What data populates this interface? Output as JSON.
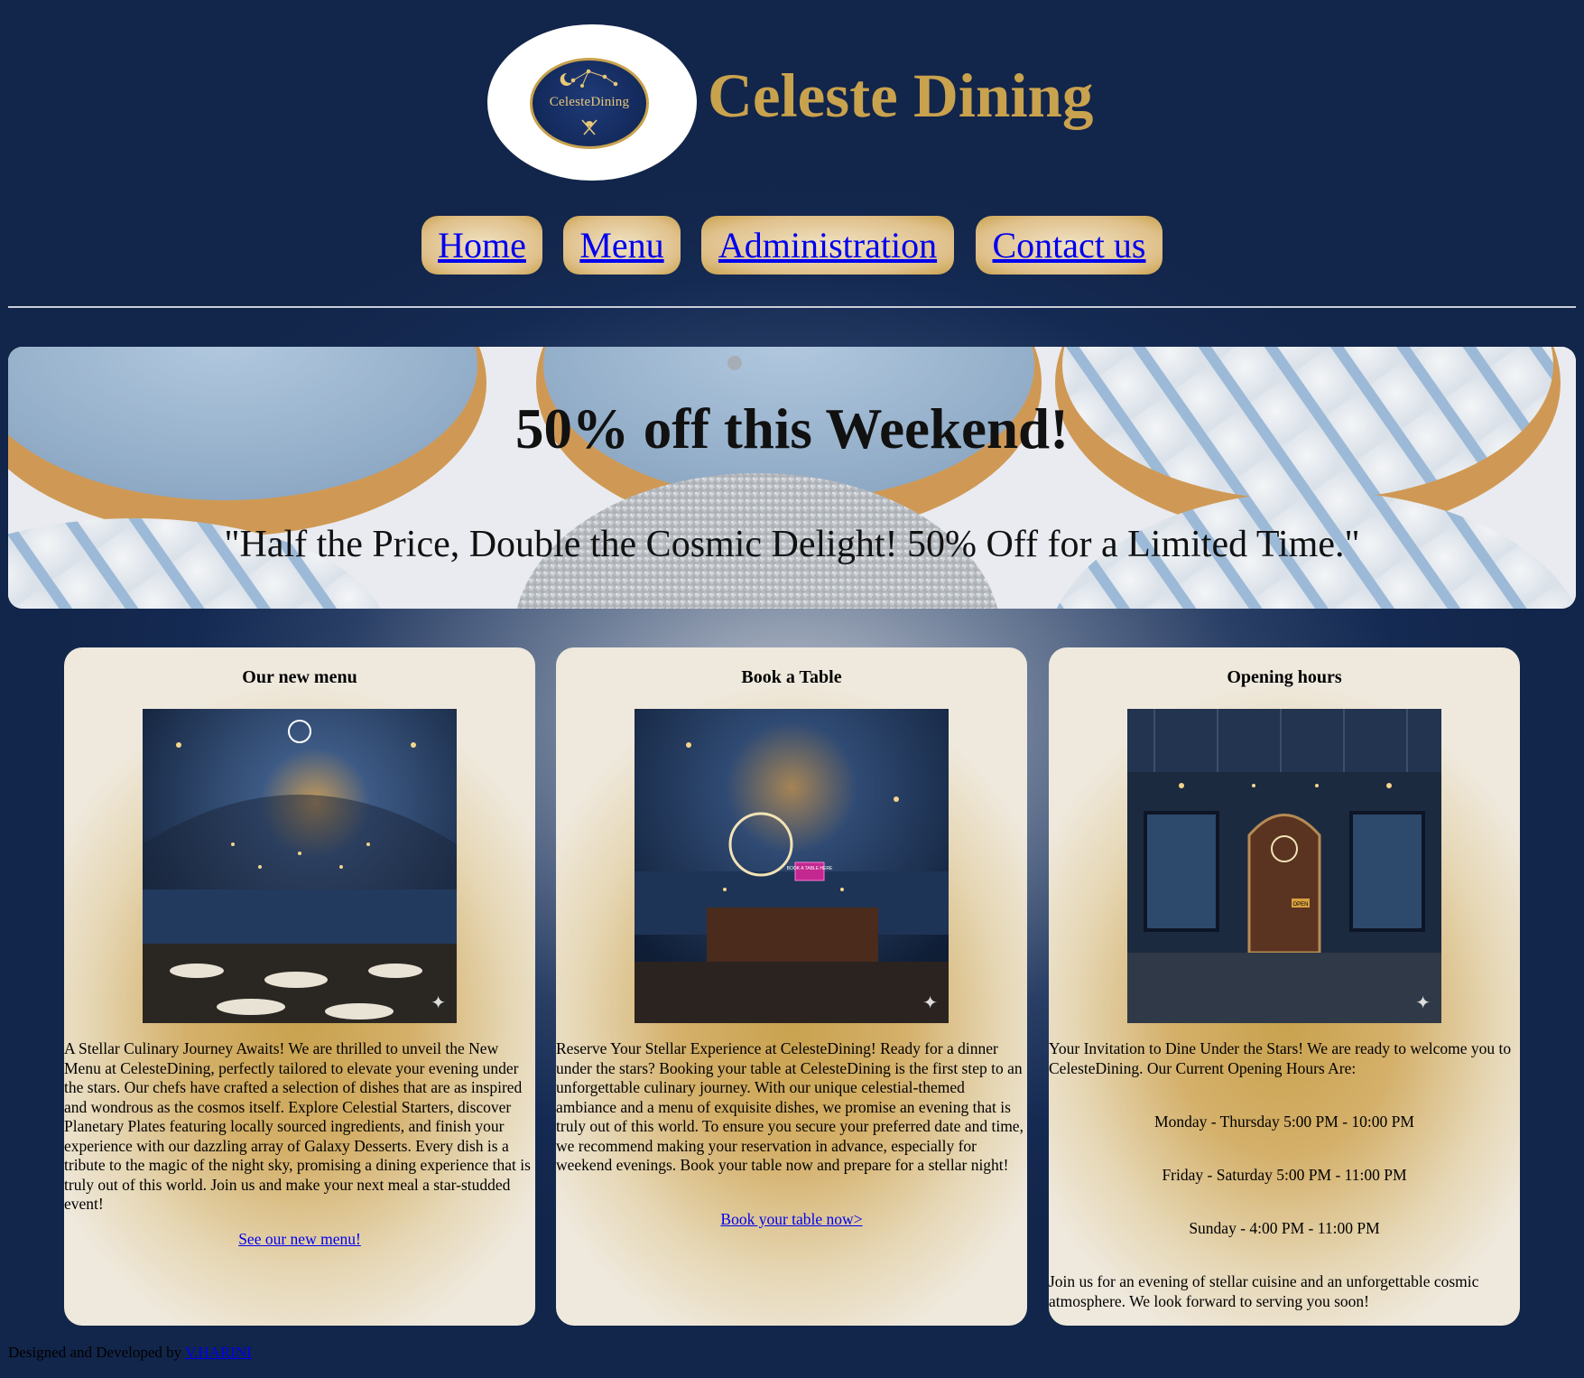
{
  "header": {
    "logo_text": "CelesteDining",
    "title": "Celeste Dining"
  },
  "nav": {
    "items": [
      "Home",
      "Menu",
      "Administration",
      "Contact us"
    ]
  },
  "banner": {
    "heading": "50% off this Weekend!",
    "tagline": "\"Half the Price, Double the Cosmic Delight! 50% Off for a Limited Time.\""
  },
  "cards": [
    {
      "title": "Our new menu",
      "text": "A Stellar Culinary Journey Awaits! We are thrilled to unveil the New Menu at CelesteDining, perfectly tailored to elevate your evening under the stars. Our chefs have crafted a selection of dishes that are as inspired and wondrous as the cosmos itself. Explore Celestial Starters, discover Planetary Plates featuring locally sourced ingredients, and finish your experience with our dazzling array of Galaxy Desserts. Every dish is a tribute to the magic of the night sky, promising a dining experience that is truly out of this world. Join us and make your next meal a star-studded event!",
      "link": "See our new menu!"
    },
    {
      "title": "Book a Table",
      "text": "Reserve Your Stellar Experience at CelesteDining! Ready for a dinner under the stars? Booking your table at CelesteDining is the first step to an unforgettable culinary journey. With our unique celestial-themed ambiance and a menu of exquisite dishes, we promise an evening that is truly out of this world. To ensure you secure your preferred date and time, we recommend making your reservation in advance, especially for weekend evenings. Book your table now and prepare for a stellar night!",
      "link": "Book your table now>",
      "image_sign": "BOOK A TABLE HERE"
    },
    {
      "title": "Opening hours",
      "intro": "Your Invitation to Dine Under the Stars! We are ready to welcome you to CelesteDining. Our Current Opening Hours Are:",
      "hours": [
        "Monday - Thursday 5:00 PM - 10:00 PM",
        "Friday - Saturday 5:00 PM - 11:00 PM",
        "Sunday - 4:00 PM - 11:00 PM"
      ],
      "outro": "Join us for an evening of stellar cuisine and an unforgettable cosmic atmosphere. We look forward to serving you soon!",
      "image_sign": "OPEN"
    }
  ],
  "footer": {
    "text": "Designed and Developed by ",
    "author": "V.HARINI"
  },
  "colors": {
    "gold": "#c9a24e",
    "navy": "#12254a",
    "link": "#0000ee"
  }
}
